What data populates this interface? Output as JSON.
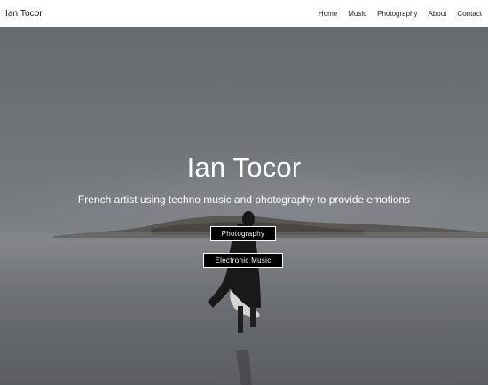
{
  "navbar": {
    "brand": "Ian Tocor",
    "links": [
      {
        "label": "Home"
      },
      {
        "label": "Music"
      },
      {
        "label": "Photography"
      },
      {
        "label": "About"
      },
      {
        "label": "Contact"
      }
    ]
  },
  "hero": {
    "title": "Ian Tocor",
    "subtitle": "French artist using techno music and photography to provide emotions",
    "buttons": [
      {
        "label": "Photography"
      },
      {
        "label": "Electronic Music"
      }
    ]
  },
  "colors": {
    "navbar_background": "#ffffff",
    "button_background": "#000000",
    "button_border": "#ffffff",
    "hero_text": "#ffffff"
  }
}
